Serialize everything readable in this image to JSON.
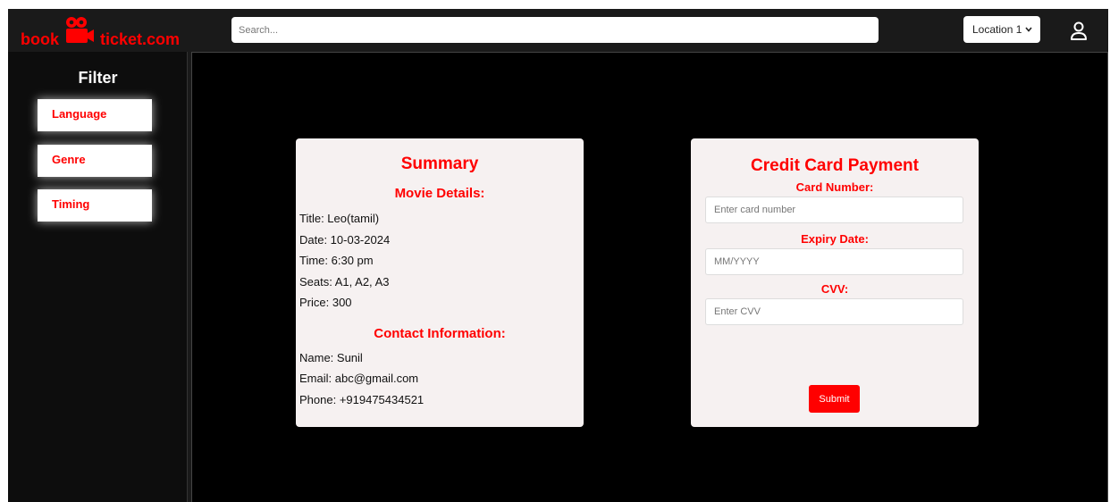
{
  "header": {
    "logo_left": "book",
    "logo_right": "ticket.com",
    "brand_color": "#ff0000",
    "search_placeholder": "Search...",
    "location": "Location 1",
    "user_icon": "user-icon"
  },
  "sidebar": {
    "title": "Filter",
    "items": [
      {
        "label": "Language"
      },
      {
        "label": "Genre"
      },
      {
        "label": "Timing"
      }
    ]
  },
  "summary": {
    "title": "Summary",
    "movie_heading": "Movie Details:",
    "movie_lines": [
      "Title: Leo(tamil)",
      "Date: 10-03-2024",
      "Time: 6:30 pm",
      "Seats: A1, A2, A3",
      "Price: 300"
    ],
    "contact_heading": "Contact Information:",
    "contact_lines": [
      "Name: Sunil",
      "Email: abc@gmail.com",
      "Phone: +919475434521"
    ]
  },
  "payment": {
    "title": "Credit Card Payment",
    "card_label": "Card Number:",
    "card_placeholder": "Enter card number",
    "expiry_label": "Expiry Date:",
    "expiry_placeholder": "MM/YYYY",
    "cvv_label": "CVV:",
    "cvv_placeholder": "Enter CVV",
    "submit_label": "Submit"
  }
}
